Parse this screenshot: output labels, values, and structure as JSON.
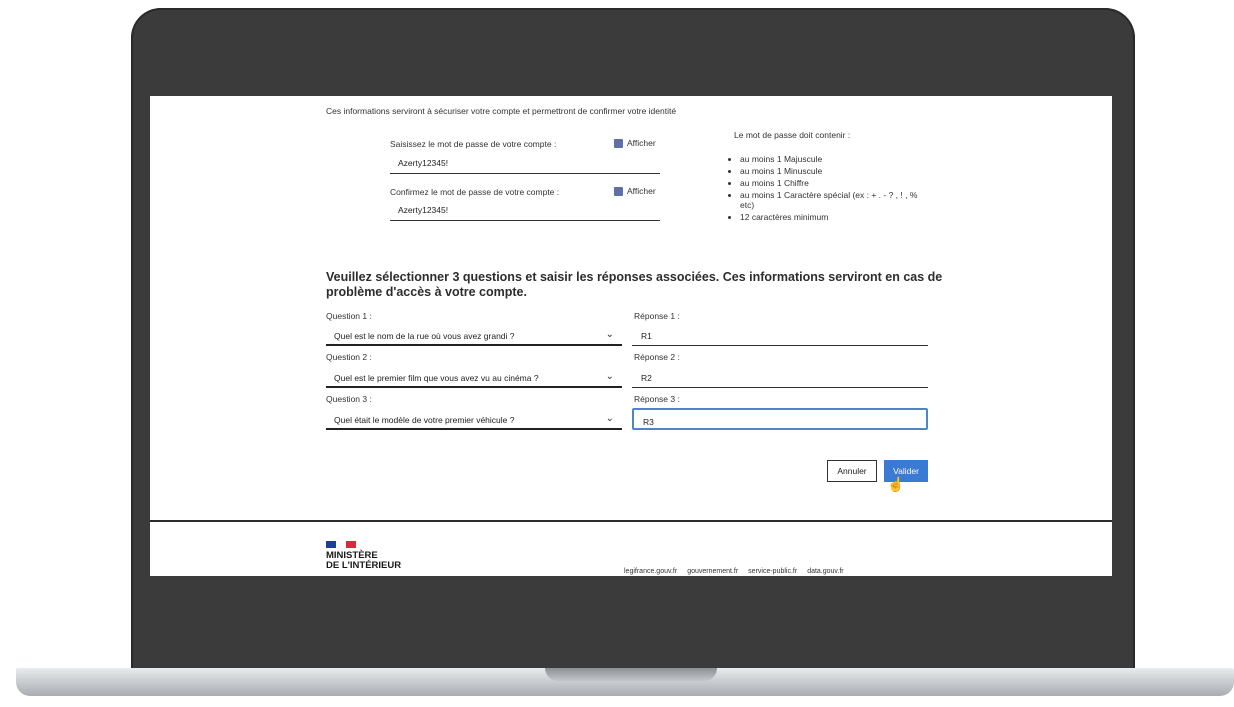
{
  "intro": "Ces informations serviront à sécuriser votre compte et permettront de confirmer votre identité",
  "password": {
    "label": "Saisissez le mot de passe de votre compte :",
    "value": "Azerty12345!",
    "show_label": "Afficher"
  },
  "confirm": {
    "label": "Confirmez le mot de passe de votre compte :",
    "value": "Azerty12345!",
    "show_label": "Afficher"
  },
  "rules": {
    "title": "Le mot de passe doit contenir :",
    "items": [
      "au moins 1 Majuscule",
      "au moins 1 Minuscule",
      "au moins 1 Chiffre",
      "au moins 1 Caractère spécial (ex : + . - ? , ! , % etc)",
      "12 caractères minimum"
    ]
  },
  "security_heading": "Veuillez sélectionner 3 questions et saisir les réponses associées. Ces informations serviront en cas de problème d'accès à votre compte.",
  "questions": [
    {
      "label": "Question 1 :",
      "value": "Quel est le nom de la rue où vous avez grandi ?",
      "answer_label": "Réponse 1 :",
      "answer": "R1"
    },
    {
      "label": "Question 2 :",
      "value": "Quel est le premier film que vous avez vu au cinéma ?",
      "answer_label": "Réponse 2 :",
      "answer": "R2"
    },
    {
      "label": "Question 3 :",
      "value": "Quel était le modèle de votre premier véhicule ?",
      "answer_label": "Réponse 3 :",
      "answer": "R3"
    }
  ],
  "buttons": {
    "cancel": "Annuler",
    "submit": "Valider"
  },
  "footer": {
    "ministry_line1": "MINISTÈRE",
    "ministry_line2": "DE L'INTÉRIEUR",
    "links": [
      "legifrance.gouv.fr",
      "gouvernement.fr",
      "service-public.fr",
      "data.gouv.fr"
    ]
  },
  "colors": {
    "primary_button": "#3a7ad4",
    "focus_border": "#4a86c8",
    "checkbox": "#5f6fa8"
  }
}
